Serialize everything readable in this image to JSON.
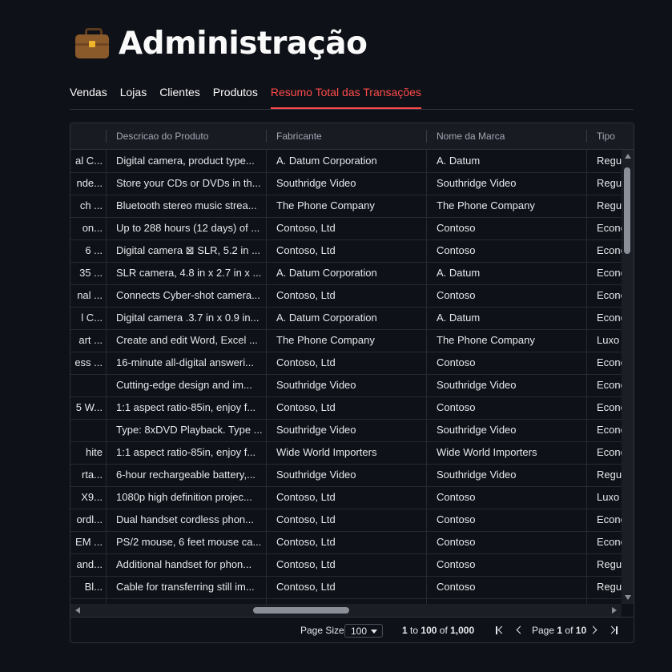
{
  "page": {
    "title": "Administração",
    "title_icon": "briefcase-icon"
  },
  "tabs": [
    {
      "label": "Vendas",
      "active": false
    },
    {
      "label": "Lojas",
      "active": false
    },
    {
      "label": "Clientes",
      "active": false
    },
    {
      "label": "Produtos",
      "active": false
    },
    {
      "label": "Resumo Total das Transações",
      "active": true
    }
  ],
  "grid": {
    "columns": [
      "",
      "Descricao do Produto",
      "Fabricante",
      "Nome da Marca",
      "Tipo"
    ],
    "rows": [
      [
        "al C...",
        "Digital camera, product type...",
        "A. Datum Corporation",
        "A. Datum",
        "Regul"
      ],
      [
        "nde...",
        "Store your CDs or DVDs in th...",
        "Southridge Video",
        "Southridge Video",
        "Regul"
      ],
      [
        "ch ...",
        "Bluetooth stereo music strea...",
        "The Phone Company",
        "The Phone Company",
        "Regul"
      ],
      [
        "on...",
        "Up to 288 hours (12 days) of ...",
        "Contoso, Ltd",
        "Contoso",
        "Econô"
      ],
      [
        "6 ...",
        "Digital camera ⊠ SLR, 5.2 in ...",
        "Contoso, Ltd",
        "Contoso",
        "Econô"
      ],
      [
        "35 ...",
        "SLR camera, 4.8 in x 2.7 in x ...",
        "A. Datum Corporation",
        "A. Datum",
        "Econô"
      ],
      [
        "nal ...",
        "Connects Cyber-shot camera...",
        "Contoso, Ltd",
        "Contoso",
        "Econô"
      ],
      [
        "l C...",
        "Digital camera .3.7 in x 0.9 in...",
        "A. Datum Corporation",
        "A. Datum",
        "Econô"
      ],
      [
        "art ...",
        "Create and edit Word, Excel ...",
        "The Phone Company",
        "The Phone Company",
        "Luxo"
      ],
      [
        "ess ...",
        "16-minute all-digital answeri...",
        "Contoso, Ltd",
        "Contoso",
        "Econô"
      ],
      [
        "",
        "Cutting-edge design and im...",
        "Southridge Video",
        "Southridge Video",
        "Econô"
      ],
      [
        "5 W...",
        "1:1 aspect ratio-85in, enjoy f...",
        "Contoso, Ltd",
        "Contoso",
        "Econô"
      ],
      [
        "",
        "Type: 8xDVD Playback. Type ...",
        "Southridge Video",
        "Southridge Video",
        "Econô"
      ],
      [
        "hite",
        "1:1 aspect ratio-85in, enjoy f...",
        "Wide World Importers",
        "Wide World Importers",
        "Econô"
      ],
      [
        "rta...",
        "6-hour rechargeable battery,...",
        "Southridge Video",
        "Southridge Video",
        "Regul"
      ],
      [
        "X9...",
        "1080p high definition projec...",
        "Contoso, Ltd",
        "Contoso",
        "Luxo"
      ],
      [
        "ordl...",
        "Dual handset cordless phon...",
        "Contoso, Ltd",
        "Contoso",
        "Econô"
      ],
      [
        "EM ...",
        "PS/2 mouse, 6 feet mouse ca...",
        "Contoso, Ltd",
        "Contoso",
        "Econô"
      ],
      [
        "and...",
        "Additional handset for phon...",
        "Contoso, Ltd",
        "Contoso",
        "Regul"
      ],
      [
        "Bl...",
        "Cable for transferring still im...",
        "Contoso, Ltd",
        "Contoso",
        "Regul"
      ],
      [
        "",
        "",
        "",
        "",
        ""
      ]
    ]
  },
  "pagination": {
    "page_size_label": "Page Size:",
    "page_size_value": "100",
    "range_from": "1",
    "range_to_word": "to",
    "range_to": "100",
    "of_word": "of",
    "total": "1,000",
    "page_word": "Page",
    "current_page": "1",
    "page_of_word": "of",
    "total_pages": "10"
  },
  "colors": {
    "background": "#0e1117",
    "accent": "#ff4b4b",
    "text": "#fafafa"
  }
}
